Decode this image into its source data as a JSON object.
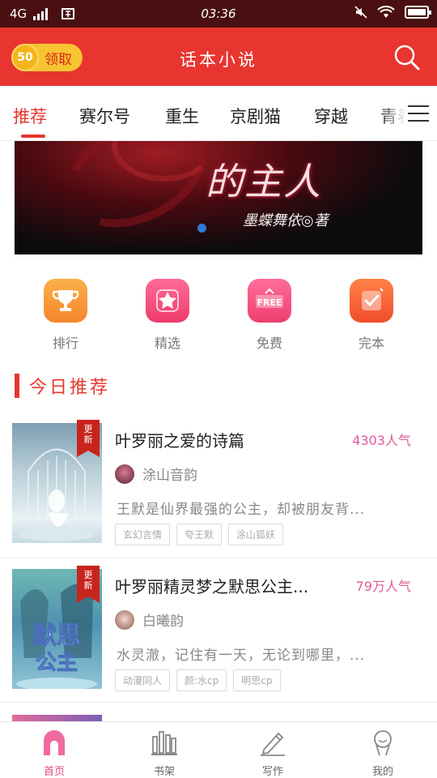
{
  "status_bar": {
    "network": "4G",
    "time": "03:36"
  },
  "header": {
    "coin_value": "50",
    "coin_label": "领取",
    "title": "话本小说"
  },
  "tabs": [
    {
      "label": "推荐",
      "active": true
    },
    {
      "label": "赛尔号"
    },
    {
      "label": "重生"
    },
    {
      "label": "京剧猫"
    },
    {
      "label": "穿越"
    },
    {
      "label": "青春"
    }
  ],
  "banner": {
    "title": "的主人",
    "author": "墨蝶舞依◎著"
  },
  "quick_actions": [
    {
      "label": "排行",
      "icon": "trophy-icon",
      "color": "#f7962b"
    },
    {
      "label": "精选",
      "icon": "star-icon",
      "color": "#f14a79"
    },
    {
      "label": "免费",
      "icon": "free-tag-icon",
      "color": "#f04a7a"
    },
    {
      "label": "完本",
      "icon": "check-icon",
      "color": "#f55a34"
    }
  ],
  "section": {
    "title": "今日推荐"
  },
  "books": [
    {
      "title": "叶罗丽之爱的诗篇",
      "popularity": "4303人气",
      "author": "涂山音韵",
      "blurb": "王默是仙界最强的公主，却被朋友背...",
      "tags": [
        "玄幻言情",
        "夸王默",
        "涂山狐妖"
      ],
      "badge": "更新"
    },
    {
      "title": "叶罗丽精灵梦之默思公主...",
      "popularity": "79万人气",
      "author": "白曦韵",
      "blurb": "水灵澈，记住有一天，无论到哪里，...",
      "tags": [
        "动漫同人",
        "颜:水cp",
        "明思cp"
      ],
      "badge": "更新"
    }
  ],
  "bottom_nav": [
    {
      "label": "首页",
      "icon": "home-icon",
      "active": true
    },
    {
      "label": "书架",
      "icon": "bookshelf-icon"
    },
    {
      "label": "写作",
      "icon": "pen-icon"
    },
    {
      "label": "我的",
      "icon": "profile-icon"
    }
  ],
  "colors": {
    "primary": "#e8352f",
    "accent_pink": "#e8457a",
    "status_bar": "#4a0f10",
    "coin": "#f7c531"
  }
}
